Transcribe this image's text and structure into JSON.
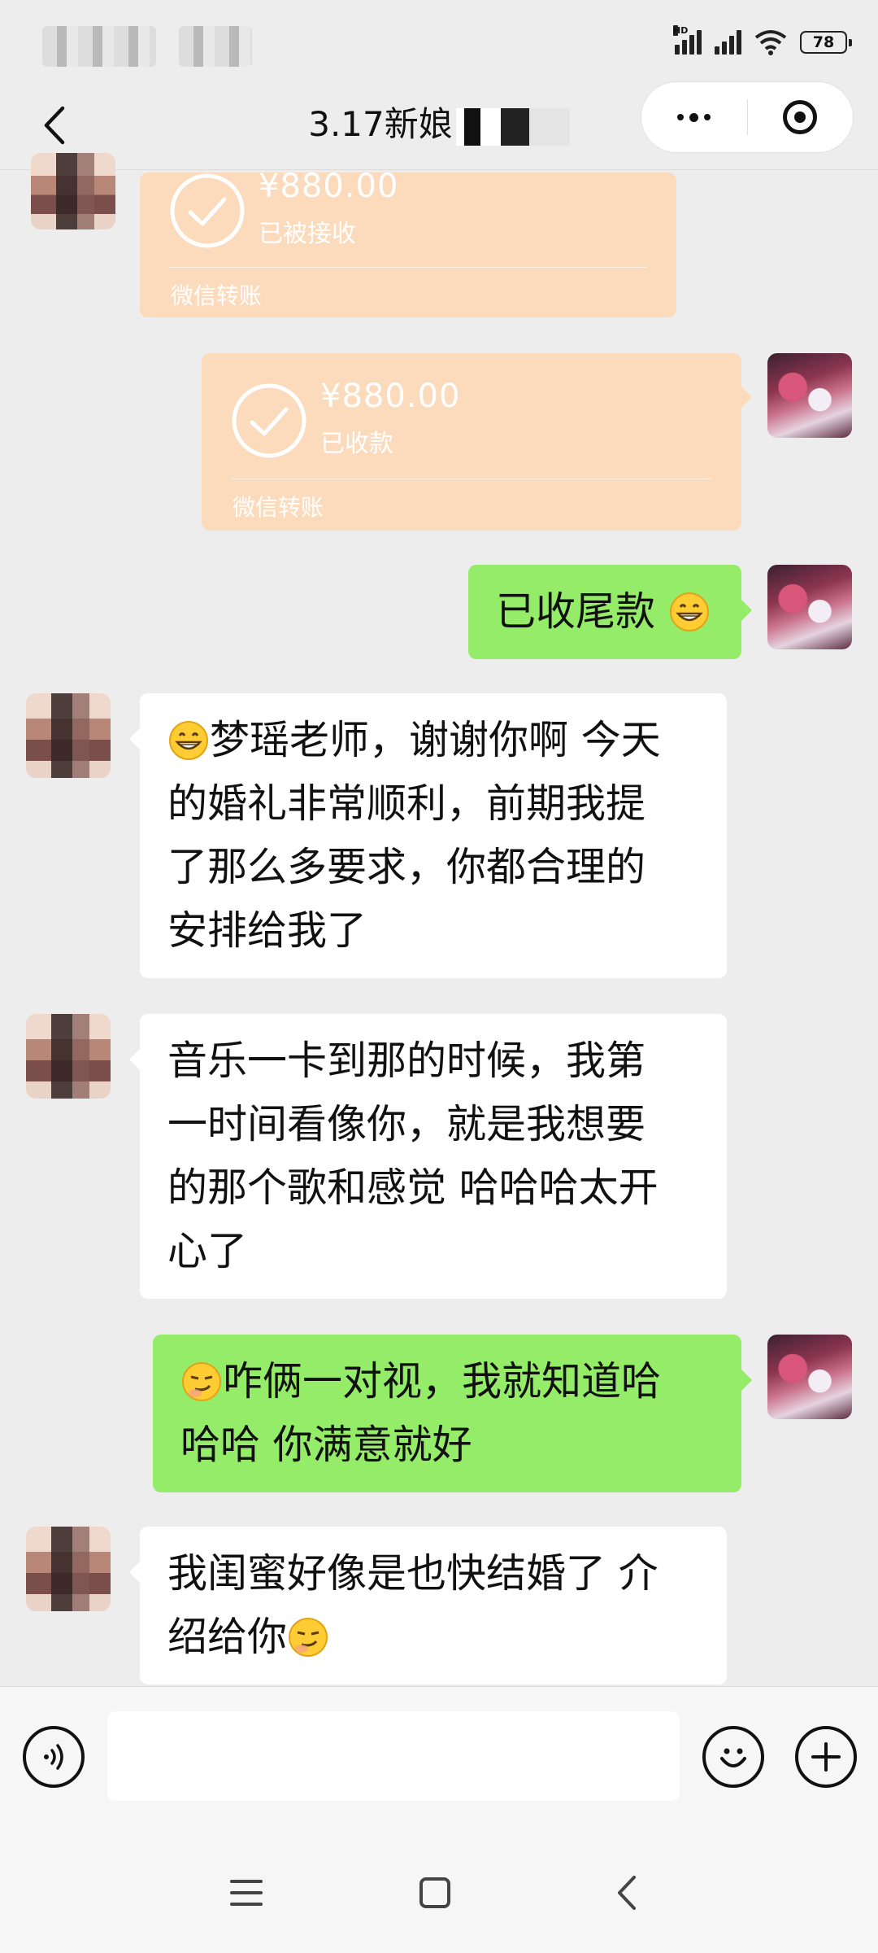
{
  "status_bar": {
    "network_label": "HD",
    "battery_level": "78"
  },
  "header": {
    "title": "3.17新娘"
  },
  "messages": {
    "transfer_received": {
      "amount": "¥880.00",
      "status": "已被接收",
      "label": "微信转账"
    },
    "transfer_collected": {
      "amount": "¥880.00",
      "status": "已收款",
      "label": "微信转账"
    },
    "msg1": {
      "text": "已收尾款"
    },
    "msg2": {
      "lines": [
        "梦瑶老师，谢谢你啊 今天",
        "的婚礼非常顺利，前期我提",
        "了那么多要求，你都合理的",
        "安排给我了"
      ]
    },
    "msg3": {
      "lines": [
        "音乐一卡到那的时候，我第",
        "一时间看像你，就是我想要",
        "的那个歌和感觉 哈哈哈太开",
        "心了"
      ]
    },
    "msg4": {
      "lines": [
        "咋俩一对视，我就知道哈",
        "哈哈 你满意就好"
      ]
    },
    "msg5": {
      "lines": [
        "我闺蜜好像是也快结婚了 介",
        "绍给你"
      ]
    }
  },
  "icons": {
    "back": "back-arrow-icon",
    "more": "more-dots-icon",
    "record": "record-target-icon",
    "voice": "voice-icon",
    "emoji": "emoji-icon",
    "add": "plus-icon",
    "transfer_check": "check-circle-icon"
  },
  "input": {
    "placeholder": ""
  },
  "colors": {
    "background": "#ededed",
    "my_bubble": "#95ec69",
    "their_bubble": "#ffffff",
    "transfer_card": "#fbdbbc"
  }
}
